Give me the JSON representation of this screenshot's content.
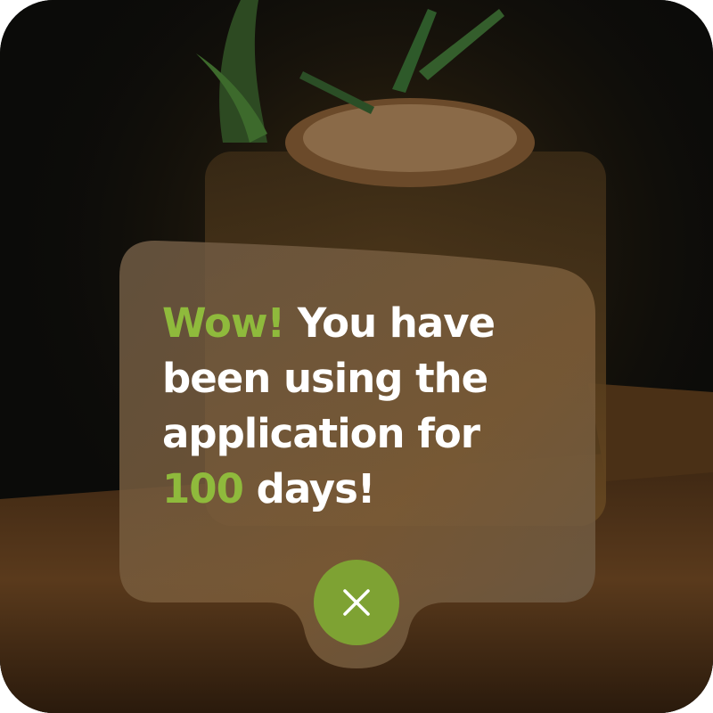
{
  "dialog": {
    "message_exclaim": "Wow!",
    "message_part1": "You have been using the application for",
    "message_count": "100",
    "message_part2": "days!",
    "close_icon": "close-icon"
  },
  "colors": {
    "accent": "#8fba3c",
    "close_button": "#7ea233",
    "text": "#ffffff"
  }
}
